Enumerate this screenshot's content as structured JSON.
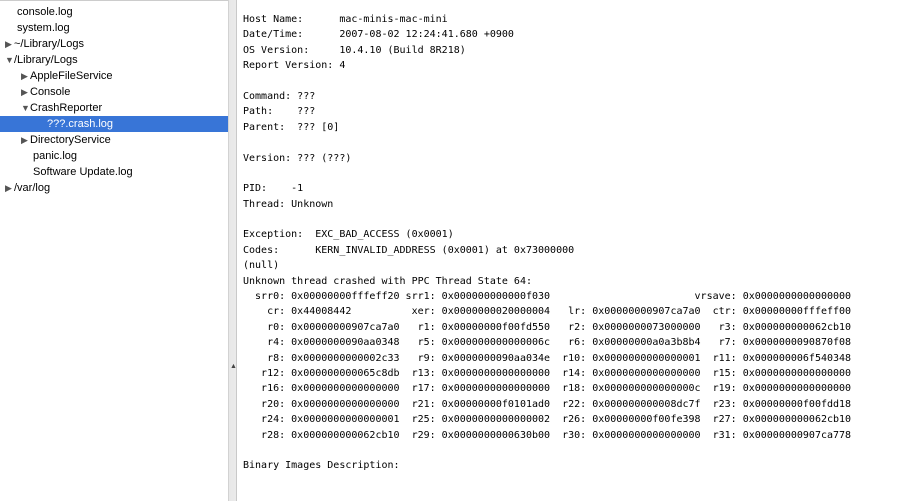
{
  "sidebar": {
    "items": [
      {
        "label": "console.log",
        "indent": 1,
        "arrow": "none"
      },
      {
        "label": "system.log",
        "indent": 1,
        "arrow": "none"
      },
      {
        "label": "~/Library/Logs",
        "indent": 0,
        "arrow": "collapsed"
      },
      {
        "label": "/Library/Logs",
        "indent": 0,
        "arrow": "expanded"
      },
      {
        "label": "AppleFileService",
        "indent": 1,
        "arrow": "collapsed"
      },
      {
        "label": "Console",
        "indent": 1,
        "arrow": "collapsed"
      },
      {
        "label": "CrashReporter",
        "indent": 1,
        "arrow": "expanded"
      },
      {
        "label": "???.crash.log",
        "indent": 2,
        "arrow": "none",
        "selected": true
      },
      {
        "label": "DirectoryService",
        "indent": 1,
        "arrow": "collapsed"
      },
      {
        "label": "panic.log",
        "indent": 2,
        "arrow": "none"
      },
      {
        "label": "Software Update.log",
        "indent": 2,
        "arrow": "none"
      },
      {
        "label": "/var/log",
        "indent": 0,
        "arrow": "collapsed"
      }
    ]
  },
  "colors": {
    "selection": "#3875d7"
  },
  "log": {
    "lines": [
      "Host Name:      mac-minis-mac-mini",
      "Date/Time:      2007-08-02 12:24:41.680 +0900",
      "OS Version:     10.4.10 (Build 8R218)",
      "Report Version: 4",
      "",
      "Command: ???",
      "Path:    ???",
      "Parent:  ??? [0]",
      "",
      "Version: ??? (???)",
      "",
      "PID:    -1",
      "Thread: Unknown",
      "",
      "Exception:  EXC_BAD_ACCESS (0x0001)",
      "Codes:      KERN_INVALID_ADDRESS (0x0001) at 0x73000000",
      "(null)",
      "Unknown thread crashed with PPC Thread State 64:",
      "  srr0: 0x00000000fffeff20 srr1: 0x000000000000f030                        vrsave: 0x0000000000000000",
      "    cr: 0x44008442          xer: 0x0000000020000004   lr: 0x00000000907ca7a0  ctr: 0x00000000fffeff00",
      "    r0: 0x00000000907ca7a0   r1: 0x00000000f00fd550   r2: 0x0000000073000000   r3: 0x000000000062cb10",
      "    r4: 0x0000000090aa0348   r5: 0x000000000000006c   r6: 0x00000000a0a3b8b4   r7: 0x0000000090870f08",
      "    r8: 0x0000000000002c33   r9: 0x0000000090aa034e  r10: 0x0000000000000001  r11: 0x000000006f540348",
      "   r12: 0x000000000065c8db  r13: 0x0000000000000000  r14: 0x0000000000000000  r15: 0x0000000000000000",
      "   r16: 0x0000000000000000  r17: 0x0000000000000000  r18: 0x000000000000000c  r19: 0x0000000000000000",
      "   r20: 0x0000000000000000  r21: 0x00000000f0101ad0  r22: 0x000000000008dc7f  r23: 0x00000000f00fdd18",
      "   r24: 0x0000000000000001  r25: 0x0000000000000002  r26: 0x00000000f00fe398  r27: 0x000000000062cb10",
      "   r28: 0x000000000062cb10  r29: 0x0000000000630b00  r30: 0x0000000000000000  r31: 0x00000000907ca778",
      "",
      "Binary Images Description:"
    ]
  }
}
